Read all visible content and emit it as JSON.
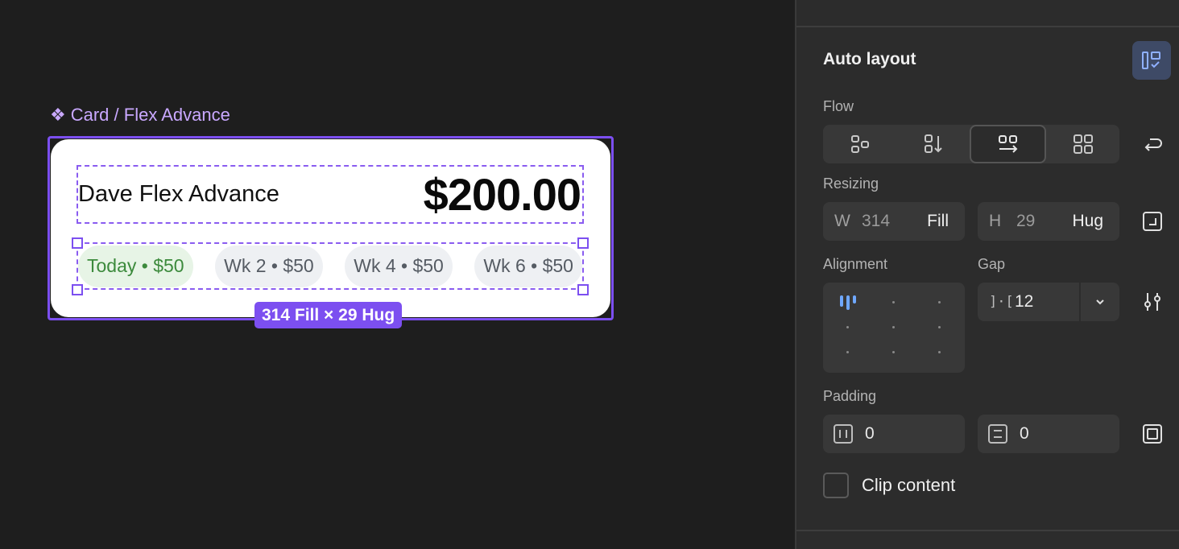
{
  "canvas": {
    "frame_label": "Card / Flex Advance",
    "component_icon": "component-icon",
    "card": {
      "title": "Dave Flex Advance",
      "amount": "$200.00",
      "chips": [
        {
          "label": "Today • $50",
          "active": true
        },
        {
          "label": "Wk 2 • $50",
          "active": false
        },
        {
          "label": "Wk 4 • $50",
          "active": false
        },
        {
          "label": "Wk 6 • $50",
          "active": false
        }
      ]
    },
    "dimension_badge": "314 Fill × 29 Hug",
    "colors": {
      "selection": "#7c4ff0",
      "active_chip_bg": "#e7f4e6",
      "active_chip_text": "#3c8a3c"
    }
  },
  "panel": {
    "title": "Auto layout",
    "flow": {
      "label": "Flow",
      "options": [
        "free-form-icon",
        "vertical-icon",
        "horizontal-icon",
        "grid-icon"
      ],
      "selected": "horizontal-icon"
    },
    "resizing": {
      "label": "Resizing",
      "width": {
        "prefix": "W",
        "value": "314",
        "mode": "Fill"
      },
      "height": {
        "prefix": "H",
        "value": "29",
        "mode": "Hug"
      }
    },
    "alignment": {
      "label": "Alignment",
      "selected": "top-left"
    },
    "gap": {
      "label": "Gap",
      "value": "12"
    },
    "padding": {
      "label": "Padding",
      "horizontal": "0",
      "vertical": "0"
    },
    "clip_content": {
      "label": "Clip content",
      "checked": false
    }
  }
}
